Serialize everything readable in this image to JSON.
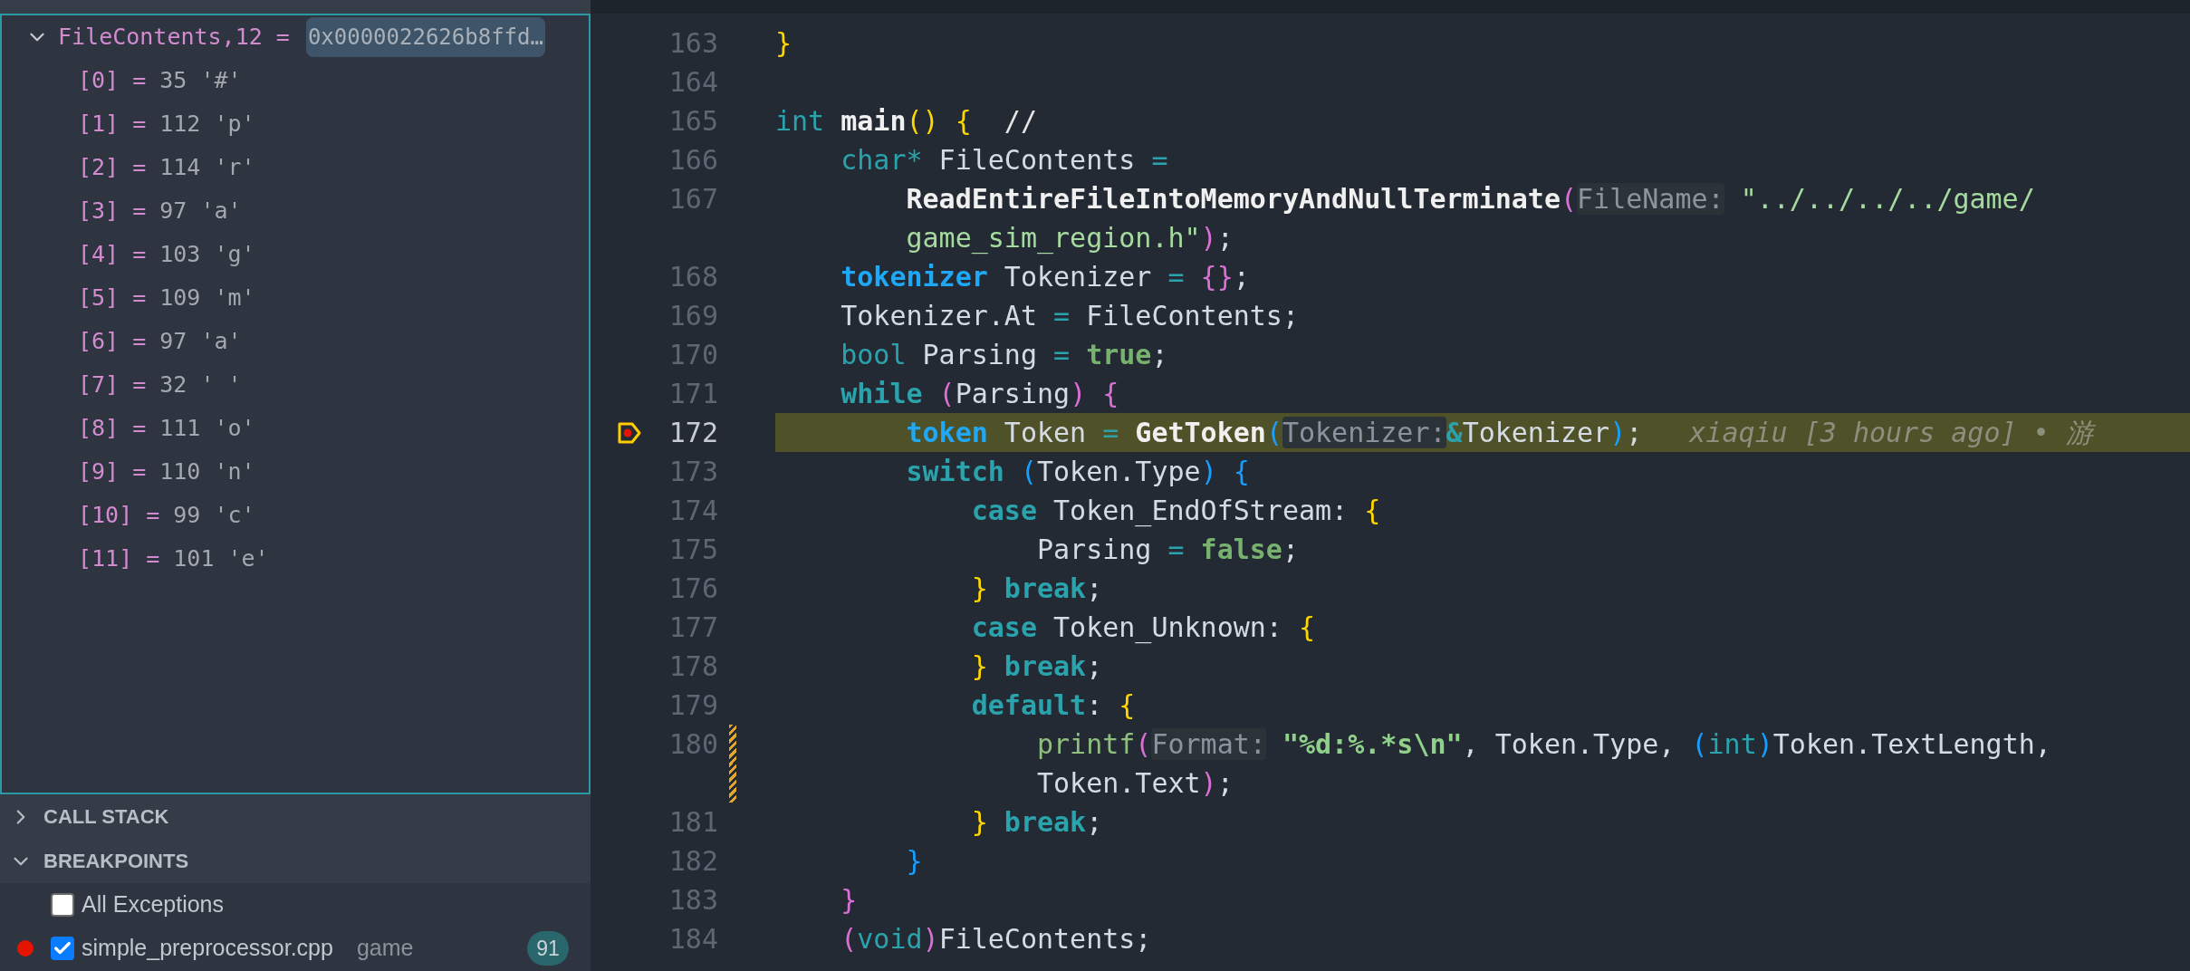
{
  "variables": {
    "expression": {
      "name": "FileContents,12 =",
      "value": "0x0000022626b8ffd…",
      "expanded": true
    },
    "children": [
      {
        "index": "[0] =",
        "value": "35 '#'"
      },
      {
        "index": "[1] =",
        "value": "112 'p'"
      },
      {
        "index": "[2] =",
        "value": "114 'r'"
      },
      {
        "index": "[3] =",
        "value": "97 'a'"
      },
      {
        "index": "[4] =",
        "value": "103 'g'"
      },
      {
        "index": "[5] =",
        "value": "109 'm'"
      },
      {
        "index": "[6] =",
        "value": "97 'a'"
      },
      {
        "index": "[7] =",
        "value": "32 ' '"
      },
      {
        "index": "[8] =",
        "value": "111 'o'"
      },
      {
        "index": "[9] =",
        "value": "110 'n'"
      },
      {
        "index": "[10] =",
        "value": "99 'c'"
      },
      {
        "index": "[11] =",
        "value": "101 'e'"
      }
    ]
  },
  "sections": [
    {
      "title": "CALL STACK",
      "expanded": false
    },
    {
      "title": "BREAKPOINTS",
      "expanded": true
    }
  ],
  "breakpoints": [
    {
      "label": "All Exceptions",
      "checked": false
    },
    {
      "label": "simple_preprocessor.cpp",
      "folder": "game",
      "count": "91",
      "checked": true,
      "enabled_dot": true
    }
  ],
  "code": {
    "rows": [
      {
        "number": "163",
        "tokens": [
          {
            "kind": "py",
            "text": "}"
          }
        ]
      },
      {
        "number": "164"
      },
      {
        "number": "165",
        "tokens": [
          {
            "kind": "kw",
            "text": "int "
          },
          {
            "kind": "fn",
            "text": "main"
          },
          {
            "kind": "py",
            "text": "() {"
          },
          {
            "kind": "comment",
            "text": "  //"
          }
        ]
      },
      {
        "number": "166",
        "tokens": [
          {
            "kind": "kw",
            "text": "    char"
          },
          {
            "kind": "op",
            "text": "*"
          },
          {
            "kind": "text",
            "text": " FileContents "
          },
          {
            "kind": "op",
            "text": "="
          }
        ]
      },
      {
        "number": "167",
        "tokens": [
          {
            "kind": "fn",
            "text": "        ReadEntireFileIntoMemoryAndNullTerminate"
          },
          {
            "kind": "pp",
            "text": "("
          },
          {
            "kind": "hint",
            "text": "FileName:"
          },
          {
            "kind": "str",
            "text": " \"../../../../game/"
          }
        ]
      },
      {
        "tokens": [
          {
            "kind": "str",
            "text": "        game_sim_region.h\""
          },
          {
            "kind": "pp",
            "text": ")"
          },
          {
            "kind": "text",
            "text": ";"
          }
        ]
      },
      {
        "number": "168",
        "tokens": [
          {
            "kind": "type",
            "text": "    tokenizer"
          },
          {
            "kind": "text",
            "text": " Tokenizer "
          },
          {
            "kind": "op",
            "text": "="
          },
          {
            "kind": "pp",
            "text": " {}"
          },
          {
            "kind": "text",
            "text": ";"
          }
        ]
      },
      {
        "number": "169",
        "tokens": [
          {
            "kind": "text",
            "text": "    Tokenizer.At "
          },
          {
            "kind": "op",
            "text": "="
          },
          {
            "kind": "text",
            "text": " FileContents;"
          }
        ]
      },
      {
        "number": "170",
        "tokens": [
          {
            "kind": "kw",
            "text": "    bool"
          },
          {
            "kind": "text",
            "text": " Parsing "
          },
          {
            "kind": "op",
            "text": "="
          },
          {
            "kind": "bool",
            "text": " true"
          },
          {
            "kind": "text",
            "text": ";"
          }
        ]
      },
      {
        "number": "171",
        "tokens": [
          {
            "kind": "kwb",
            "text": "    while"
          },
          {
            "kind": "pp",
            "text": " ("
          },
          {
            "kind": "text",
            "text": "Parsing"
          },
          {
            "kind": "pp",
            "text": ") {"
          }
        ]
      },
      {
        "number": "172",
        "current": true,
        "breakpoint": true,
        "blame": "xiaqiu [3 hours ago] • 游",
        "tokens": [
          {
            "kind": "type",
            "text": "        token"
          },
          {
            "kind": "text",
            "text": " Token "
          },
          {
            "kind": "op",
            "text": "="
          },
          {
            "kind": "fn",
            "text": " GetToken"
          },
          {
            "kind": "pb",
            "text": "("
          },
          {
            "kind": "hint",
            "text": "Tokenizer:"
          },
          {
            "kind": "opb",
            "text": "&"
          },
          {
            "kind": "text",
            "text": "Tokenizer"
          },
          {
            "kind": "pb",
            "text": ")"
          },
          {
            "kind": "text",
            "text": ";"
          }
        ]
      },
      {
        "number": "173",
        "tokens": [
          {
            "kind": "kwb",
            "text": "        switch"
          },
          {
            "kind": "pb",
            "text": " ("
          },
          {
            "kind": "text",
            "text": "Token.Type"
          },
          {
            "kind": "pb",
            "text": ") {"
          }
        ]
      },
      {
        "number": "174",
        "tokens": [
          {
            "kind": "kwb",
            "text": "            case"
          },
          {
            "kind": "text",
            "text": " Token_EndOfStream: "
          },
          {
            "kind": "py",
            "text": "{"
          }
        ]
      },
      {
        "number": "175",
        "tokens": [
          {
            "kind": "text",
            "text": "                Parsing "
          },
          {
            "kind": "op",
            "text": "="
          },
          {
            "kind": "bool",
            "text": " false"
          },
          {
            "kind": "text",
            "text": ";"
          }
        ]
      },
      {
        "number": "176",
        "tokens": [
          {
            "kind": "py",
            "text": "            }"
          },
          {
            "kind": "kwb",
            "text": " break"
          },
          {
            "kind": "text",
            "text": ";"
          }
        ]
      },
      {
        "number": "177",
        "tokens": [
          {
            "kind": "kwb",
            "text": "            case"
          },
          {
            "kind": "text",
            "text": " Token_Unknown: "
          },
          {
            "kind": "py",
            "text": "{"
          }
        ]
      },
      {
        "number": "178",
        "tokens": [
          {
            "kind": "py",
            "text": "            }"
          },
          {
            "kind": "kwb",
            "text": " break"
          },
          {
            "kind": "text",
            "text": ";"
          }
        ]
      },
      {
        "number": "179",
        "tokens": [
          {
            "kind": "kwb",
            "text": "            default"
          },
          {
            "kind": "text",
            "text": ": "
          },
          {
            "kind": "py",
            "text": "{"
          }
        ]
      },
      {
        "number": "180",
        "changed": true,
        "tokens": [
          {
            "kind": "fn2",
            "text": "                printf"
          },
          {
            "kind": "pp",
            "text": "("
          },
          {
            "kind": "hint",
            "text": "Format:"
          },
          {
            "kind": "strb",
            "text": " \"%d:%.*s\\n\""
          },
          {
            "kind": "text",
            "text": ", Token.Type, "
          },
          {
            "kind": "pb",
            "text": "("
          },
          {
            "kind": "kw",
            "text": "int"
          },
          {
            "kind": "pb",
            "text": ")"
          },
          {
            "kind": "text",
            "text": "Token.TextLength,"
          }
        ]
      },
      {
        "changed": true,
        "tokens": [
          {
            "kind": "text",
            "text": "                Token.Text"
          },
          {
            "kind": "pp",
            "text": ")"
          },
          {
            "kind": "text",
            "text": ";"
          }
        ]
      },
      {
        "number": "181",
        "tokens": [
          {
            "kind": "py",
            "text": "            }"
          },
          {
            "kind": "kwb",
            "text": " break"
          },
          {
            "kind": "text",
            "text": ";"
          }
        ]
      },
      {
        "number": "182",
        "tokens": [
          {
            "kind": "pb",
            "text": "        }"
          }
        ]
      },
      {
        "number": "183",
        "tokens": [
          {
            "kind": "pp",
            "text": "    }"
          }
        ]
      },
      {
        "number": "184",
        "tokens": [
          {
            "kind": "pp",
            "text": "    ("
          },
          {
            "kind": "kw",
            "text": "void"
          },
          {
            "kind": "pp",
            "text": ")"
          },
          {
            "kind": "text",
            "text": "FileContents;"
          }
        ]
      }
    ]
  }
}
